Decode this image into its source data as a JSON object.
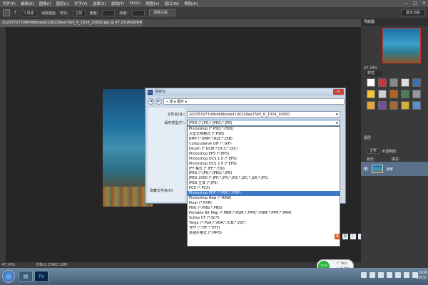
{
  "menubar": {
    "items": [
      "文件(F)",
      "编辑(E)",
      "图像(I)",
      "图层(L)",
      "文字(Y)",
      "选择(S)",
      "滤镜(T)",
      "3D(D)",
      "视图(V)",
      "窗口(W)",
      "帮助(H)"
    ],
    "window_buttons": [
      "—",
      "□",
      "✕"
    ]
  },
  "options": {
    "size_label": "T",
    "size_value": "0 像素",
    "antialias": "消除锯齿",
    "style_label": "样式:",
    "style_value": "正常",
    "width_label": "宽度:",
    "height_label": "高度:",
    "refine_button": "调整边缘...",
    "workspace": "基本功能"
  },
  "document_tab": {
    "label": "2d2357b73d9b4b6bbebd1d0226ea75b5_R_1024_10000.jpg @ 47.2%(RGB/8#)"
  },
  "dialog": {
    "title": "另存为",
    "close": "✕",
    "breadcrumb": "« 库 ▸ 图片 ▸",
    "back_icon": "◀",
    "forward_icon": "▶",
    "filename_label": "文件名(N):",
    "filename_value": "2d2357b73d9b4b6bbebd1d0226ea75b5_R_1024_10000",
    "filetype_label": "保存类型(T):",
    "filetype_value": "JPEG (*.JPG;*.JPEG;*.JPE)",
    "hide_folders": "隐藏文件夹(H)",
    "format_options": [
      "Photoshop (*.PSD;*.PDD)",
      "大型文档格式 (*.PSB)",
      "BMP (*.BMP;*.RLE;*.DIB)",
      "CompuServe GIF (*.GIF)",
      "Dicom (*.DCM;*.DC3;*.DIC)",
      "Photoshop EPS (*.EPS)",
      "Photoshop DCS 1.0 (*.EPS)",
      "Photoshop DCS 2.0 (*.EPS)",
      "IFF 格式 (*.IFF;*.TDI)",
      "JPEG (*.JPG;*.JPEG;*.JPE)",
      "JPEG 2000 (*.JPF;*.JPX;*.JP2;*.J2C;*.J2K;*.JPC)",
      "JPEG 立体 (*.JPS)",
      "PCX (*.PCX)",
      "Photoshop PDF (*.PDF;*.PDP)",
      "Photoshop Raw (*.RAW)",
      "Pixar (*.PXR)",
      "PNG (*.PNG;*.PNS)",
      "Portable Bit Map (*.PBM;*.PGM;*.PPM;*.PNM;*.PFM;*.PAM)",
      "Scitex CT (*.SCT)",
      "Targa (*.TGA;*.VDA;*.ICB;*.VST)",
      "TIFF (*.TIF;*.TIFF)",
      "多图片格式 (*.MPO)"
    ],
    "selected_index": 13
  },
  "right_panel": {
    "navigator_tab": "导航器",
    "zoom": "47.24%",
    "swatches_tab": "样式",
    "layers_tab": "图层",
    "blend_mode": "正常",
    "opacity_label": "不透明度:",
    "lock_label": "锁定:",
    "fill_label": "填充:",
    "layer_name": "背景"
  },
  "statusbar": {
    "zoom": "47.24%",
    "doc": "文档:2.25M/2.20M"
  },
  "speed_widget": {
    "percent": "55%",
    "up": "↑ 7K/s",
    "down": "↓ 0.4K/s"
  },
  "taskbar": {
    "ps_label": "Ps",
    "clock_time": "16:4",
    "clock_date": "2015/"
  },
  "colors": {
    "selection": "#3b78c8",
    "dialog_bg": "#cdd8e5",
    "close_red": "#c9463d",
    "speed_green": "#29b339"
  }
}
